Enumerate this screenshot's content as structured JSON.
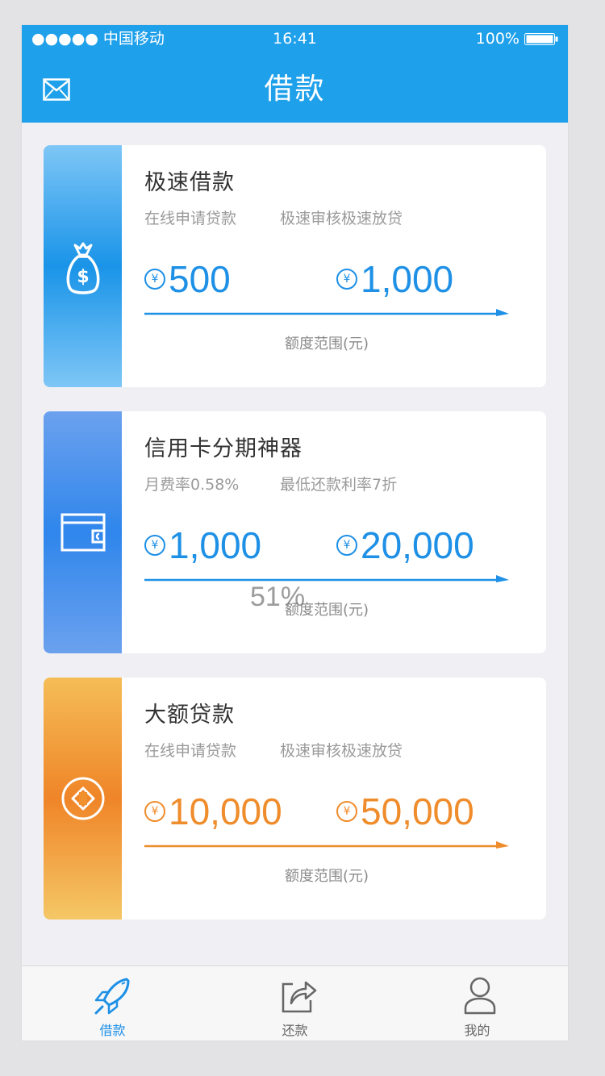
{
  "status_bar": {
    "signal": "●●●●● 中国移动",
    "time": "16:41",
    "battery": "100%"
  },
  "header": {
    "title": "借款"
  },
  "cards": [
    {
      "title": "极速借款",
      "subtitle_left": "在线申请贷款",
      "subtitle_right": "极速审核极速放贷",
      "amount_min": "500",
      "amount_max": "1,000",
      "range_label": "额度范围(元)",
      "accent": "#1e90e6",
      "icon": "money-bag-icon"
    },
    {
      "title": "信用卡分期神器",
      "subtitle_left": "月费率0.58%",
      "subtitle_right": "最低还款利率7折",
      "amount_min": "1,000",
      "amount_max": "20,000",
      "range_label": "额度范围(元)",
      "accent": "#1e90e6",
      "icon": "wallet-card-icon"
    },
    {
      "title": "大额贷款",
      "subtitle_left": "在线申请贷款",
      "subtitle_right": "极速审核极速放贷",
      "amount_min": "10,000",
      "amount_max": "50,000",
      "range_label": "额度范围(元)",
      "accent": "#ef8c2b",
      "icon": "diamond-circle-icon"
    }
  ],
  "overlay_text": "51%",
  "currency_symbol": "¥",
  "tabbar": [
    {
      "label": "借款",
      "icon": "rocket-icon",
      "active": true
    },
    {
      "label": "还款",
      "icon": "share-box-icon",
      "active": false
    },
    {
      "label": "我的",
      "icon": "user-icon",
      "active": false
    }
  ],
  "colors": {
    "header_blue": "#1fa0ea",
    "amount_blue": "#1e90e6",
    "amount_orange": "#ef8c2b",
    "tab_active": "#1e90e6",
    "tab_inactive": "#666666"
  }
}
